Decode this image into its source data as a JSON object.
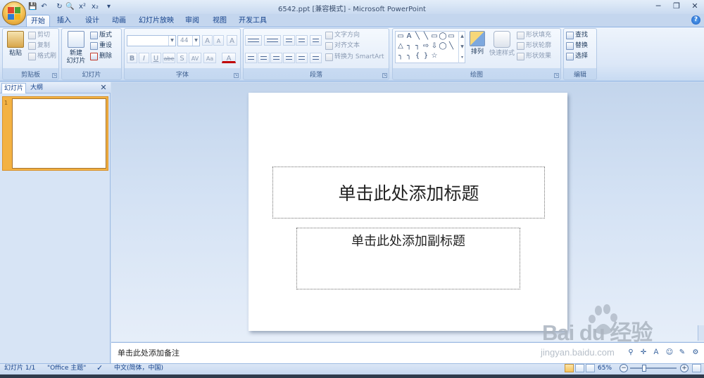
{
  "window": {
    "title": "6542.ppt [兼容模式] - Microsoft PowerPoint",
    "minimize": "─",
    "restore": "❐",
    "close": "✕"
  },
  "qat": {
    "save": "💾",
    "undo": "↶",
    "redo": "↻",
    "print_preview": "🔍",
    "superscript": "x²",
    "subscript": "x₂",
    "customize": "▾"
  },
  "tabs": [
    "开始",
    "插入",
    "设计",
    "动画",
    "幻灯片放映",
    "审阅",
    "视图",
    "开发工具"
  ],
  "help": "?",
  "ribbon": {
    "clipboard": {
      "label": "剪贴板",
      "paste": "粘贴",
      "cut": "剪切",
      "copy": "复制",
      "format_painter": "格式刷"
    },
    "slides": {
      "label": "幻灯片",
      "new_slide_line1": "新建",
      "new_slide_line2": "幻灯片",
      "layout": "版式",
      "reset": "重设",
      "delete": "删除"
    },
    "font": {
      "label": "字体",
      "font_name": "",
      "font_size": "44",
      "grow": "A",
      "shrink": "A",
      "clear": "A",
      "bold": "B",
      "italic": "I",
      "underline": "U",
      "strike": "abe",
      "shadow": "S",
      "spacing": "AV",
      "case": "Aa",
      "color": "A"
    },
    "paragraph": {
      "label": "段落",
      "text_direction": "文字方向",
      "align_text": "对齐文本",
      "convert_smartart": "转换为 SmartArt"
    },
    "drawing": {
      "label": "绘图",
      "arrange": "排列",
      "quick_styles": "快速样式",
      "shape_fill": "形状填充",
      "shape_outline": "形状轮廓",
      "shape_effects": "形状效果",
      "shapes": [
        "▭",
        "A",
        "╲",
        "╲",
        "▭",
        "◯",
        "▭",
        "△",
        "┐",
        "┐",
        "⇨",
        "⇩",
        "◯",
        "╲",
        "╮",
        "╮",
        "{",
        "}",
        "☆"
      ]
    },
    "editing": {
      "label": "编辑",
      "find": "查找",
      "replace": "替换",
      "select": "选择"
    }
  },
  "panel": {
    "tab_slides": "幻灯片",
    "tab_outline": "大纲",
    "close": "✕",
    "slide_number": "1"
  },
  "slide": {
    "title_placeholder": "单击此处添加标题",
    "subtitle_placeholder": "单击此处添加副标题"
  },
  "notes": {
    "placeholder": "单击此处添加备注"
  },
  "watermark": {
    "brand": "Bai du 经验",
    "url": "jingyan.baidu.com"
  },
  "status": {
    "slide_indicator": "幻灯片 1/1",
    "theme": "\"Office 主题\"",
    "language": "中文(简体，中国)",
    "zoom": "65%",
    "zoom_out": "−",
    "zoom_in": "+"
  },
  "colors": {
    "accent": "#15428b",
    "ribbon_border": "#8db2e3",
    "thumb_selected": "#f3b243"
  }
}
